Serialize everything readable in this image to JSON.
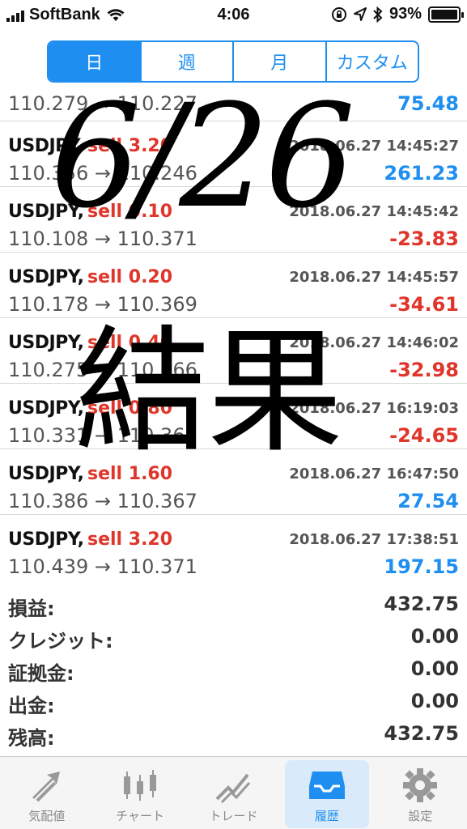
{
  "status_bar": {
    "carrier": "SoftBank",
    "time": "4:06",
    "battery": "93%",
    "battery_level": 0.93
  },
  "segments": [
    {
      "label": "日",
      "active": true
    },
    {
      "label": "週",
      "active": false
    },
    {
      "label": "月",
      "active": false
    },
    {
      "label": "カスタム",
      "active": false
    }
  ],
  "partial_row": {
    "prices": "110.279 → 110.227",
    "profit": "75.48",
    "sign": "pos"
  },
  "trades": [
    {
      "symbol": "USDJPY,",
      "side": "sell 3.20",
      "datetime": "2018.06.27 14:45:27",
      "prices": "110.356 → 110.246",
      "profit": "261.23",
      "sign": "pos"
    },
    {
      "symbol": "USDJPY,",
      "side": "sell 0.10",
      "datetime": "2018.06.27 14:45:42",
      "prices": "110.108 → 110.371",
      "profit": "-23.83",
      "sign": "neg"
    },
    {
      "symbol": "USDJPY,",
      "side": "sell 0.20",
      "datetime": "2018.06.27 14:45:57",
      "prices": "110.178 → 110.369",
      "profit": "-34.61",
      "sign": "neg"
    },
    {
      "symbol": "USDJPY,",
      "side": "sell 0.40",
      "datetime": "2018.06.27 14:46:02",
      "prices": "110.275 → 110.366",
      "profit": "-32.98",
      "sign": "neg"
    },
    {
      "symbol": "USDJPY,",
      "side": "sell 0.80",
      "datetime": "2018.06.27 16:19:03",
      "prices": "110.331 → 110.365",
      "profit": "-24.65",
      "sign": "neg"
    },
    {
      "symbol": "USDJPY,",
      "side": "sell 1.60",
      "datetime": "2018.06.27 16:47:50",
      "prices": "110.386 → 110.367",
      "profit": "27.54",
      "sign": "pos"
    },
    {
      "symbol": "USDJPY,",
      "side": "sell 3.20",
      "datetime": "2018.06.27 17:38:51",
      "prices": "110.439 → 110.371",
      "profit": "197.15",
      "sign": "pos"
    }
  ],
  "summary": [
    {
      "label": "損益:",
      "value": "432.75"
    },
    {
      "label": "クレジット:",
      "value": "0.00"
    },
    {
      "label": "証拠金:",
      "value": "0.00"
    },
    {
      "label": "出金:",
      "value": "0.00"
    },
    {
      "label": "残高:",
      "value": "432.75"
    }
  ],
  "overlay": {
    "date": "6/26",
    "result": "結果"
  },
  "tabs": [
    {
      "label": "気配値",
      "icon": "quotes-arrows-icon",
      "active": false
    },
    {
      "label": "チャート",
      "icon": "candlestick-chart-icon",
      "active": false
    },
    {
      "label": "トレード",
      "icon": "trade-line-icon",
      "active": false
    },
    {
      "label": "履歴",
      "icon": "inbox-tray-icon",
      "active": true
    },
    {
      "label": "設定",
      "icon": "gear-icon",
      "active": false
    }
  ],
  "colors": {
    "accent": "#1e8ff0",
    "negative": "#e0352a",
    "positive": "#1e8ff0"
  }
}
